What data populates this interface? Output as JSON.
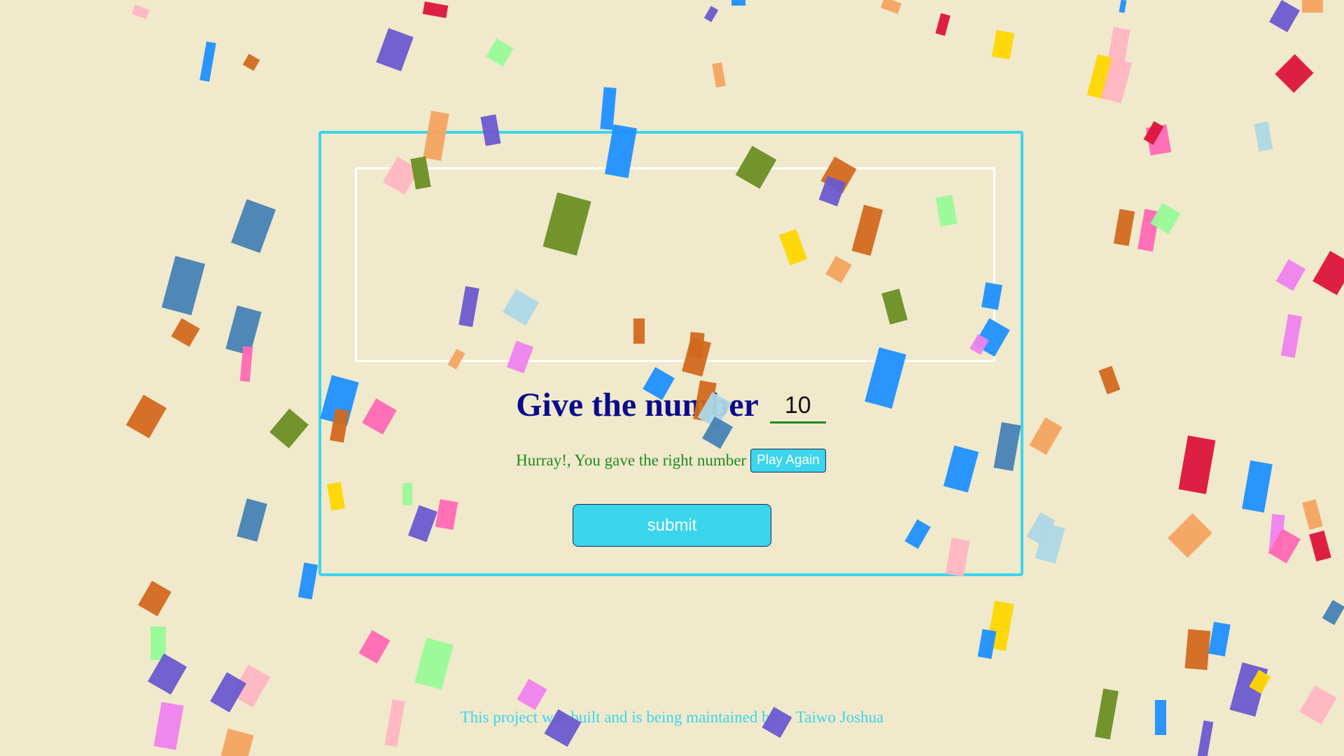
{
  "game": {
    "prompt": "Give the number",
    "input_value": "10",
    "result_message": "Hurray!, You gave the right number",
    "play_again_label": "Play Again",
    "submit_label": "submit"
  },
  "footer": {
    "text": "This project was built and is being maintained by",
    "author": "Taiwo Joshua"
  },
  "colors": {
    "background": "#f0e9cc",
    "accent": "#3bd5ec",
    "heading": "#0a0a8c",
    "success": "#1f8a1f"
  }
}
